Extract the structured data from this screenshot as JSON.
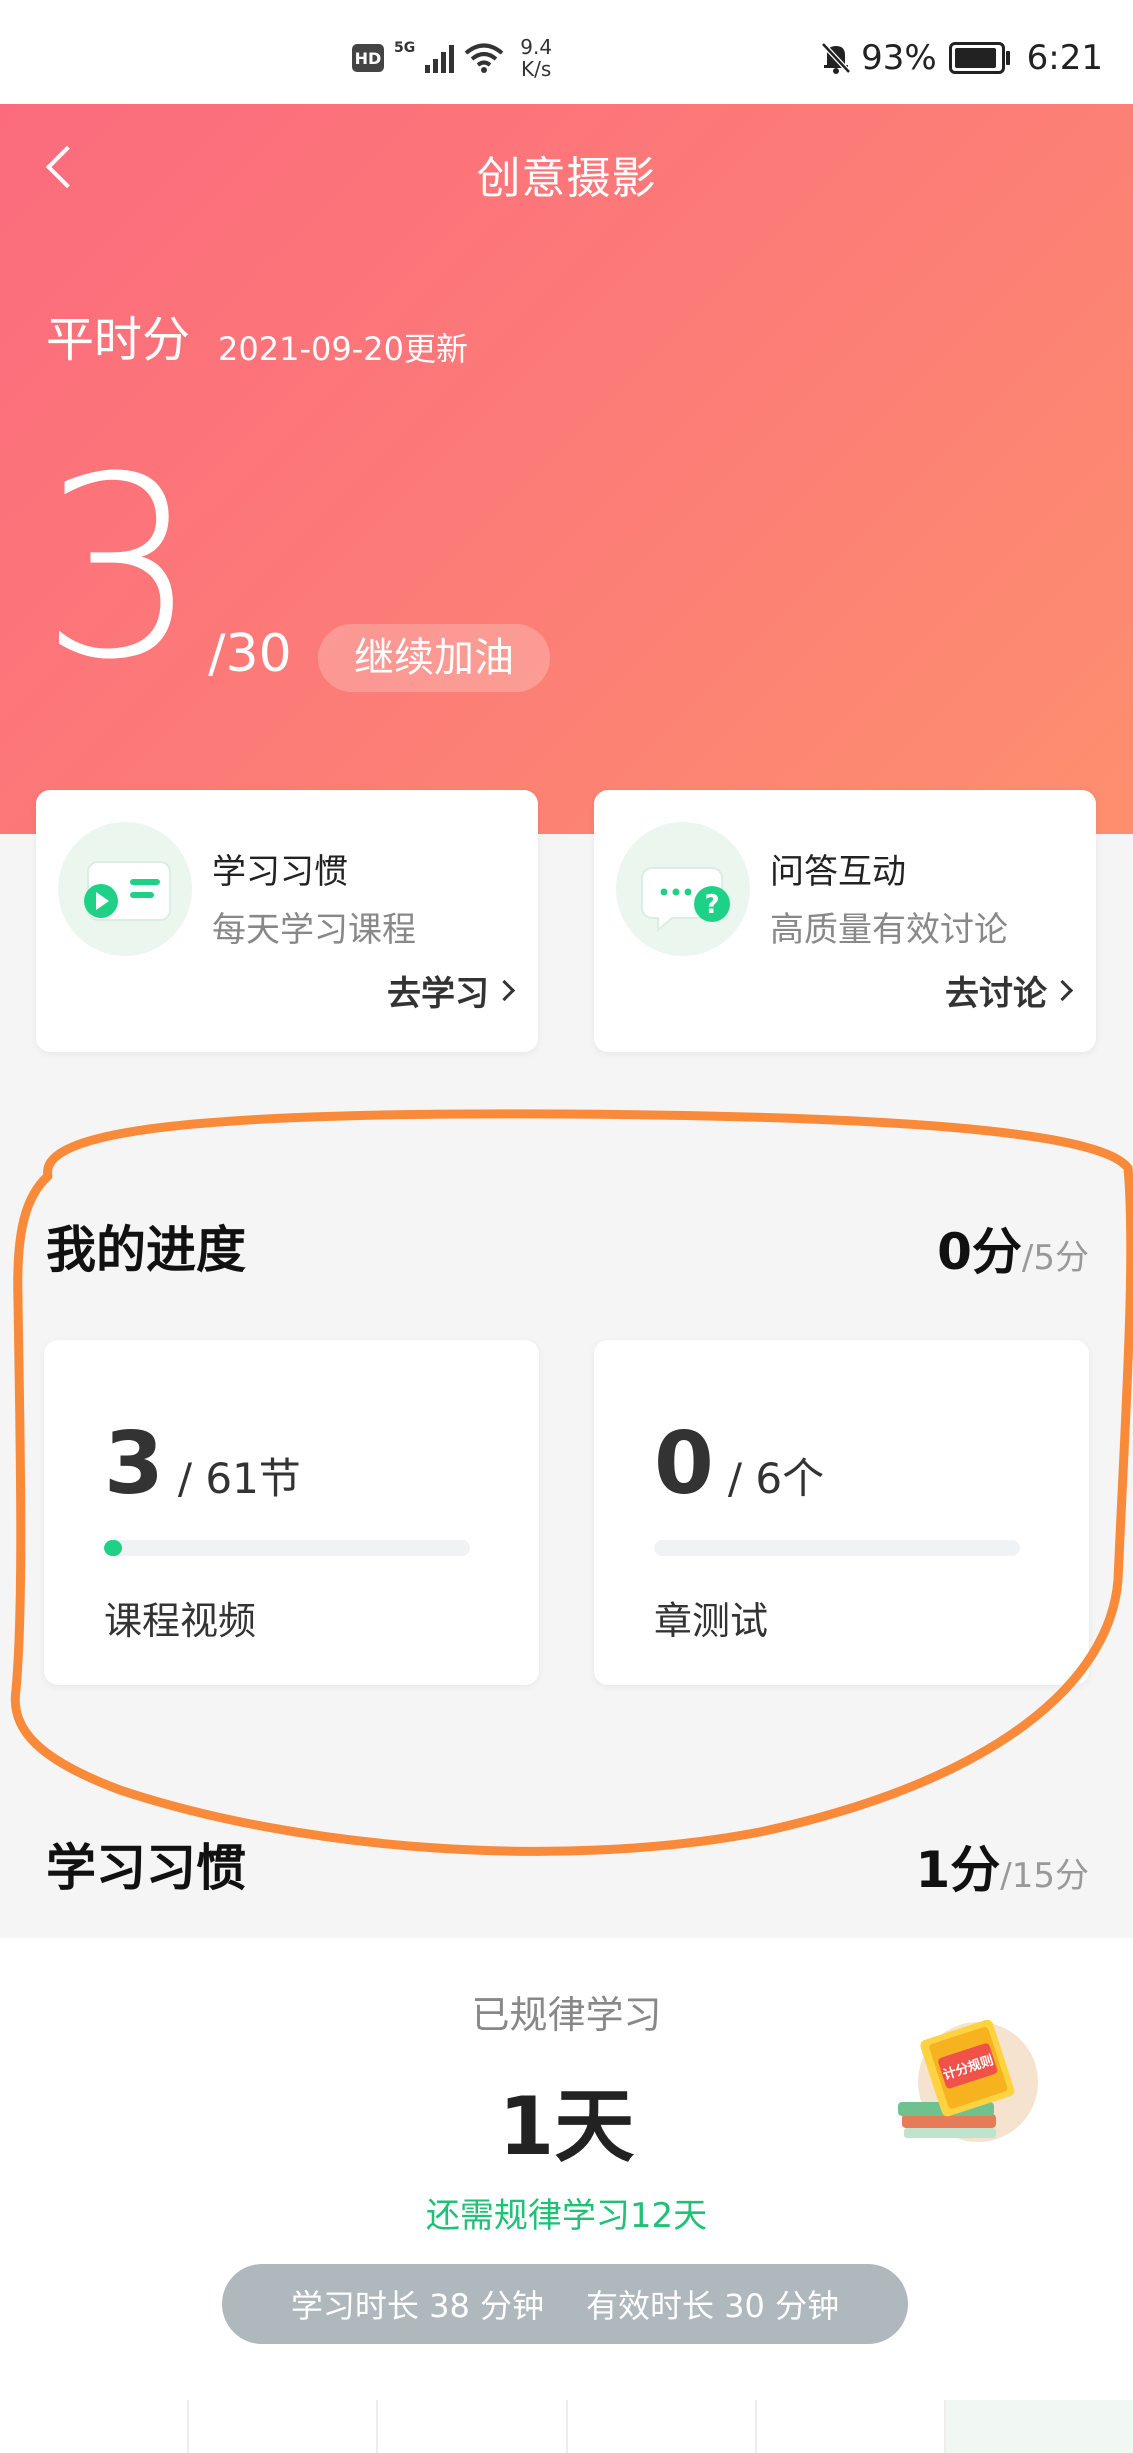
{
  "status_bar": {
    "hd": "HD",
    "signal": "5G",
    "speed_value": "9.4",
    "speed_unit": "K/s",
    "battery": "93%",
    "time": "6:21",
    "icons": [
      "bell-off-icon",
      "wifi-icon",
      "battery-icon"
    ]
  },
  "header": {
    "title": "创意摄影",
    "back_icon": "chevron-left-icon"
  },
  "score_summary": {
    "label": "平时分",
    "updated": "2021-09-20更新",
    "score": "3",
    "total": "/30",
    "encouragement": "继续加油"
  },
  "feature_cards": [
    {
      "title": "学习习惯",
      "subtitle": "每天学习课程",
      "action": "去学习",
      "icon": "video-card-icon"
    },
    {
      "title": "问答互动",
      "subtitle": "高质量有效讨论",
      "action": "去讨论",
      "icon": "chat-question-icon"
    }
  ],
  "progress_section": {
    "title": "我的进度",
    "score": "0分",
    "max": "/5分",
    "items": [
      {
        "value": "3",
        "total": "/ 61节",
        "label": "课程视频",
        "fraction": 0.049
      },
      {
        "value": "0",
        "total": "/ 6个",
        "label": "章测试",
        "fraction": 0
      }
    ]
  },
  "habit_section": {
    "title": "学习习惯",
    "score": "1分",
    "max": "/15分",
    "regular_label": "已规律学习",
    "days": "1天",
    "need_more": "还需规律学习12天",
    "study_time": "学习时长 38 分钟",
    "effective_time": "有效时长 30 分钟",
    "rule_badge": "计分规则"
  },
  "colors": {
    "hero_start": "#fb6b7d",
    "hero_end": "#fd8f6e",
    "accent_green": "#1ed186",
    "annotation_orange": "#f98a3a"
  }
}
